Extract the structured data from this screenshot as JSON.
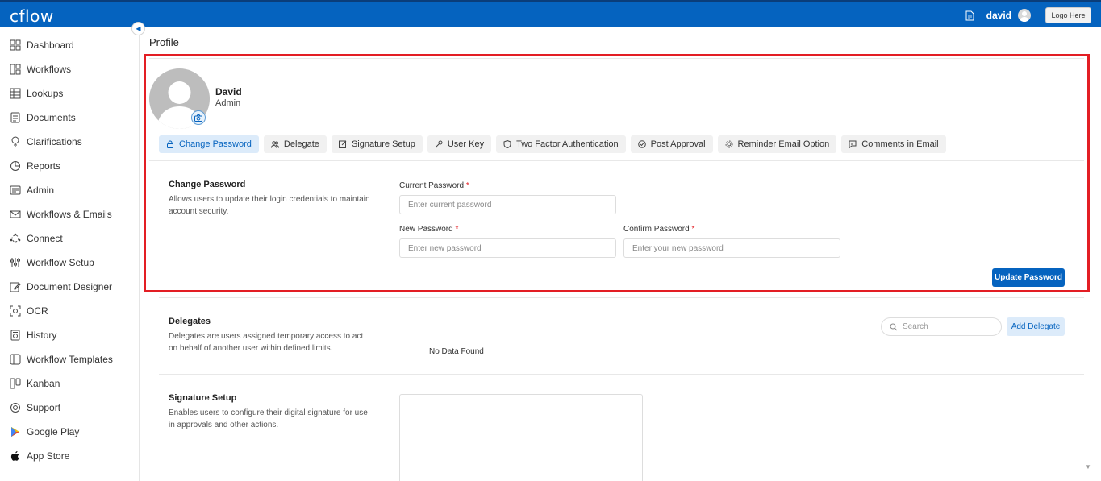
{
  "header": {
    "logo": "cflow",
    "username": "david",
    "logo_button": "Logo Here"
  },
  "sidebar": {
    "items": [
      {
        "label": "Dashboard",
        "icon": "dashboard-icon"
      },
      {
        "label": "Workflows",
        "icon": "workflows-icon"
      },
      {
        "label": "Lookups",
        "icon": "table-icon"
      },
      {
        "label": "Documents",
        "icon": "document-icon"
      },
      {
        "label": "Clarifications",
        "icon": "lightbulb-icon"
      },
      {
        "label": "Reports",
        "icon": "pie-chart-icon"
      },
      {
        "label": "Admin",
        "icon": "admin-icon"
      },
      {
        "label": "Workflows & Emails",
        "icon": "mail-icon"
      },
      {
        "label": "Connect",
        "icon": "connect-icon"
      },
      {
        "label": "Workflow Setup",
        "icon": "sliders-icon"
      },
      {
        "label": "Document Designer",
        "icon": "edit-document-icon"
      },
      {
        "label": "OCR",
        "icon": "scan-icon"
      },
      {
        "label": "History",
        "icon": "history-icon"
      },
      {
        "label": "Workflow Templates",
        "icon": "template-icon"
      },
      {
        "label": "Kanban",
        "icon": "kanban-icon"
      },
      {
        "label": "Support",
        "icon": "support-icon"
      },
      {
        "label": "Google Play",
        "icon": "google-play-icon"
      },
      {
        "label": "App Store",
        "icon": "apple-icon"
      }
    ]
  },
  "page": {
    "title": "Profile"
  },
  "profile": {
    "name": "David",
    "role": "Admin"
  },
  "tabs": [
    {
      "label": "Change Password",
      "icon": "lock-icon",
      "active": true
    },
    {
      "label": "Delegate",
      "icon": "users-icon",
      "active": false
    },
    {
      "label": "Signature Setup",
      "icon": "pen-icon",
      "active": false
    },
    {
      "label": "User Key",
      "icon": "key-icon",
      "active": false
    },
    {
      "label": "Two Factor Authentication",
      "icon": "shield-icon",
      "active": false
    },
    {
      "label": "Post Approval",
      "icon": "check-circle-icon",
      "active": false
    },
    {
      "label": "Reminder Email Option",
      "icon": "gear-icon",
      "active": false
    },
    {
      "label": "Comments in Email",
      "icon": "comment-icon",
      "active": false
    }
  ],
  "change_password": {
    "title": "Change Password",
    "description": "Allows users to update their login credentials to maintain account security.",
    "current_label": "Current Password",
    "current_placeholder": "Enter current password",
    "new_label": "New Password",
    "new_placeholder": "Enter new password",
    "confirm_label": "Confirm Password",
    "confirm_placeholder": "Enter your new password",
    "required_mark": "*",
    "submit": "Update Password"
  },
  "delegates": {
    "title": "Delegates",
    "description": "Delegates are users assigned temporary access to act on behalf of another user within defined limits.",
    "search_placeholder": "Search",
    "add_button": "Add Delegate",
    "empty": "No Data Found"
  },
  "signature": {
    "title": "Signature Setup",
    "description": "Enables users to configure their digital signature for use in approvals and other actions."
  },
  "colors": {
    "brand": "#0563bf",
    "highlight": "#e31e24",
    "active_tab_bg": "#dcebfa"
  }
}
